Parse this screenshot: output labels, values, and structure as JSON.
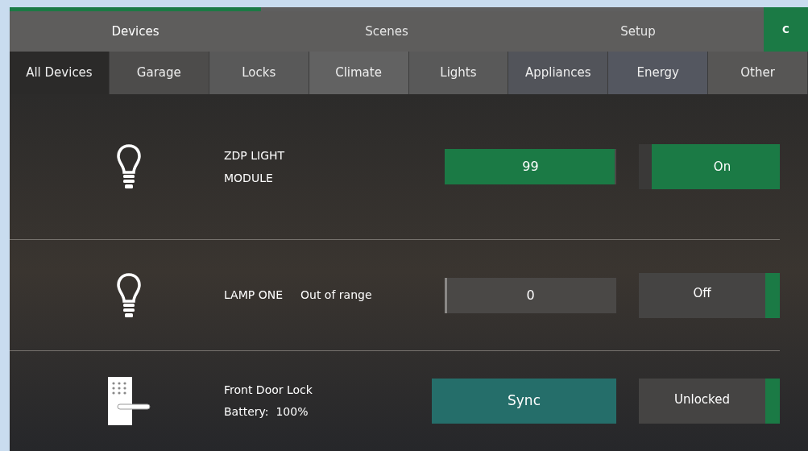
{
  "nav": [
    {
      "label": "Devices",
      "selected": true
    },
    {
      "label": "Scenes",
      "selected": false
    },
    {
      "label": "Setup",
      "selected": false
    }
  ],
  "refresh_button": {
    "label": "C"
  },
  "tabs": [
    {
      "label": "All Devices",
      "selected": true
    },
    {
      "label": "Garage",
      "selected": false
    },
    {
      "label": "Locks",
      "selected": false
    },
    {
      "label": "Climate",
      "selected": false
    },
    {
      "label": "Lights",
      "selected": false
    },
    {
      "label": "Appliances",
      "selected": false
    },
    {
      "label": "Energy",
      "selected": false
    },
    {
      "label": "Other",
      "selected": false
    }
  ],
  "devices": [
    {
      "kind": "light",
      "name": "ZDP LIGHT MODULE",
      "dimmer": {
        "value": "99",
        "level": 0.99
      },
      "toggle": {
        "label": "On",
        "on": true
      }
    },
    {
      "kind": "light",
      "name": "LAMP ONE",
      "status": "Out of range",
      "dimmer": {
        "value": "0",
        "level": 0
      },
      "toggle": {
        "label": "Off",
        "on": false
      }
    },
    {
      "kind": "lock",
      "name": "Front Door Lock",
      "battery": "Battery:  100%",
      "action": "Sync",
      "toggle": {
        "label": "Unlocked",
        "on": false
      }
    }
  ]
}
